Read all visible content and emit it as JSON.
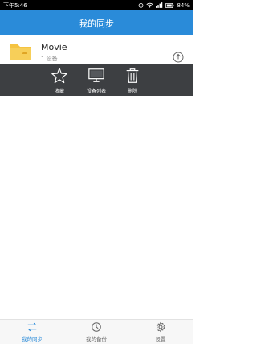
{
  "status_bar": {
    "time": "下午5:46",
    "battery": "84%",
    "icons": [
      "alarm-icon",
      "wifi-icon",
      "signal-icon",
      "battery-icon"
    ]
  },
  "header": {
    "title": "我的同步"
  },
  "list": {
    "items": [
      {
        "name": "Movie",
        "subtitle": "1 设备",
        "icon": "folder-icon",
        "action_icon": "upload-icon"
      }
    ]
  },
  "actions": [
    {
      "label": "收藏",
      "icon": "star-icon"
    },
    {
      "label": "设备列表",
      "icon": "monitor-icon"
    },
    {
      "label": "删除",
      "icon": "trash-icon"
    }
  ],
  "bottom_nav": {
    "items": [
      {
        "label": "我的同步",
        "icon": "sync-icon",
        "active": true
      },
      {
        "label": "我的备份",
        "icon": "backup-icon",
        "active": false
      },
      {
        "label": "设置",
        "icon": "gear-icon",
        "active": false
      }
    ]
  },
  "colors": {
    "accent": "#2a8bd9",
    "overlay": "#3d3f42",
    "folder": "#f5c341"
  }
}
